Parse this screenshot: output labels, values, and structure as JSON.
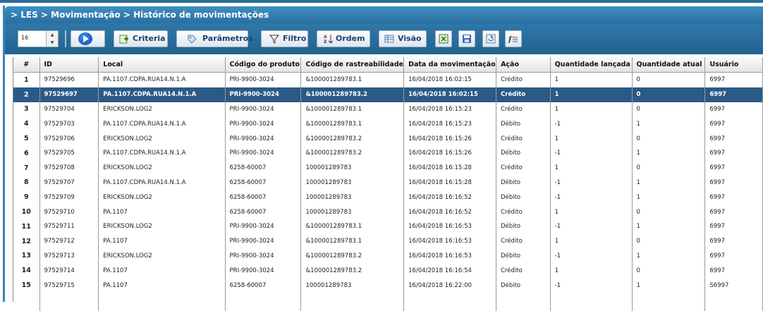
{
  "breadcrumb": "> LES > Movimentação > Histórico de movimentações",
  "toolbar": {
    "page_size": "16",
    "criteria_label": "Criteria",
    "parametros_label": "Parâmetros",
    "filtro_label": "Filtro",
    "ordem_label": "Ordem",
    "visao_label": "Visão"
  },
  "colors": {
    "title_bar": "#2a6f9f",
    "selected_row": "#2b5a86"
  },
  "table": {
    "headers": [
      "#",
      "ID",
      "Local",
      "Código do produto",
      "Código de rastreabilidade",
      "Data da movimentação",
      "Ação",
      "Quantidade lançada",
      "Quantidade atual",
      "Usuário"
    ],
    "rows": [
      {
        "n": "1",
        "id": "97529696",
        "local": "PA.1107.CDPA.RUA14.N.1.A",
        "produto": "PRI-9900-3024",
        "rastreio": "&100001289783.1",
        "data": "16/04/2018 16:02:15",
        "acao": "Crédito",
        "qtd_lancada": "1",
        "qtd_atual": "0",
        "usuario": "6997"
      },
      {
        "n": "2",
        "id": "97529697",
        "local": "PA.1107.CDPA.RUA14.N.1.A",
        "produto": "PRI-9900-3024",
        "rastreio": "&100001289783.2",
        "data": "16/04/2018 16:02:15",
        "acao": "Crédito",
        "qtd_lancada": "1",
        "qtd_atual": "0",
        "usuario": "6997"
      },
      {
        "n": "3",
        "id": "97529704",
        "local": "ERICKSON.LOG2",
        "produto": "PRI-9900-3024",
        "rastreio": "&100001289783.1",
        "data": "16/04/2018 16:15:23",
        "acao": "Crédito",
        "qtd_lancada": "1",
        "qtd_atual": "0",
        "usuario": "6997"
      },
      {
        "n": "4",
        "id": "97529703",
        "local": "PA.1107.CDPA.RUA14.N.1.A",
        "produto": "PRI-9900-3024",
        "rastreio": "&100001289783.1",
        "data": "16/04/2018 16:15:23",
        "acao": "Débito",
        "qtd_lancada": "-1",
        "qtd_atual": "1",
        "usuario": "6997"
      },
      {
        "n": "5",
        "id": "97529706",
        "local": "ERICKSON.LOG2",
        "produto": "PRI-9900-3024",
        "rastreio": "&100001289783.2",
        "data": "16/04/2018 16:15:26",
        "acao": "Crédito",
        "qtd_lancada": "1",
        "qtd_atual": "0",
        "usuario": "6997"
      },
      {
        "n": "6",
        "id": "97529705",
        "local": "PA.1107.CDPA.RUA14.N.1.A",
        "produto": "PRI-9900-3024",
        "rastreio": "&100001289783.2",
        "data": "16/04/2018 16:15:26",
        "acao": "Débito",
        "qtd_lancada": "-1",
        "qtd_atual": "1",
        "usuario": "6997"
      },
      {
        "n": "7",
        "id": "97529708",
        "local": "ERICKSON.LOG2",
        "produto": "6258-60007",
        "rastreio": "100001289783",
        "data": "16/04/2018 16:15:28",
        "acao": "Crédito",
        "qtd_lancada": "1",
        "qtd_atual": "0",
        "usuario": "6997"
      },
      {
        "n": "8",
        "id": "97529707",
        "local": "PA.1107.CDPA.RUA14.N.1.A",
        "produto": "6258-60007",
        "rastreio": "100001289783",
        "data": "16/04/2018 16:15:28",
        "acao": "Débito",
        "qtd_lancada": "-1",
        "qtd_atual": "1",
        "usuario": "6997"
      },
      {
        "n": "9",
        "id": "97529709",
        "local": "ERICKSON.LOG2",
        "produto": "6258-60007",
        "rastreio": "100001289783",
        "data": "16/04/2018 16:16:52",
        "acao": "Débito",
        "qtd_lancada": "-1",
        "qtd_atual": "1",
        "usuario": "6997"
      },
      {
        "n": "10",
        "id": "97529710",
        "local": "PA.1107",
        "produto": "6258-60007",
        "rastreio": "100001289783",
        "data": "16/04/2018 16:16:52",
        "acao": "Crédito",
        "qtd_lancada": "1",
        "qtd_atual": "0",
        "usuario": "6997"
      },
      {
        "n": "11",
        "id": "97529711",
        "local": "ERICKSON.LOG2",
        "produto": "PRI-9900-3024",
        "rastreio": "&100001289783.1",
        "data": "16/04/2018 16:16:53",
        "acao": "Débito",
        "qtd_lancada": "-1",
        "qtd_atual": "1",
        "usuario": "6997"
      },
      {
        "n": "12",
        "id": "97529712",
        "local": "PA.1107",
        "produto": "PRI-9900-3024",
        "rastreio": "&100001289783.1",
        "data": "16/04/2018 16:16:53",
        "acao": "Crédito",
        "qtd_lancada": "1",
        "qtd_atual": "0",
        "usuario": "6997"
      },
      {
        "n": "13",
        "id": "97529713",
        "local": "ERICKSON.LOG2",
        "produto": "PRI-9900-3024",
        "rastreio": "&100001289783.2",
        "data": "16/04/2018 16:16:53",
        "acao": "Débito",
        "qtd_lancada": "-1",
        "qtd_atual": "1",
        "usuario": "6997"
      },
      {
        "n": "14",
        "id": "97529714",
        "local": "PA.1107",
        "produto": "PRI-9900-3024",
        "rastreio": "&100001289783.2",
        "data": "16/04/2018 16:16:54",
        "acao": "Crédito",
        "qtd_lancada": "1",
        "qtd_atual": "0",
        "usuario": "6997"
      },
      {
        "n": "15",
        "id": "97529715",
        "local": "PA.1107",
        "produto": "6258-60007",
        "rastreio": "100001289783",
        "data": "16/04/2018 16:22:00",
        "acao": "Débito",
        "qtd_lancada": "-1",
        "qtd_atual": "1",
        "usuario": "S6997"
      }
    ],
    "selected_row": 2
  }
}
